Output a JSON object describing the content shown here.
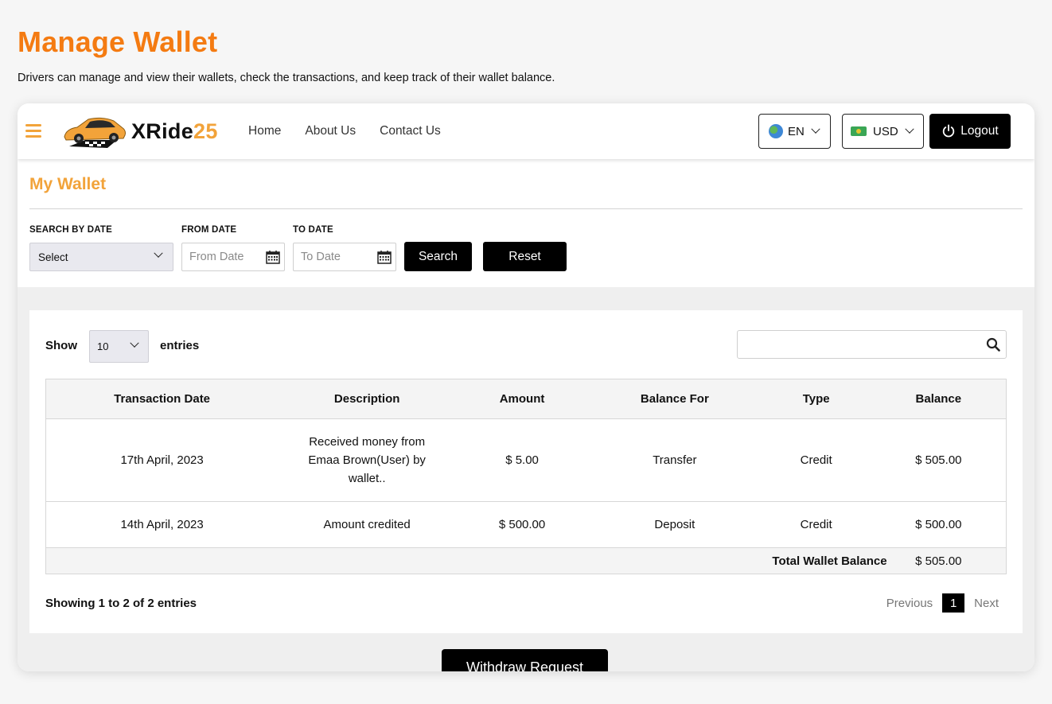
{
  "page": {
    "title": "Manage Wallet",
    "subtitle": "Drivers can manage and view their wallets, check the transactions, and keep track of their wallet balance."
  },
  "navbar": {
    "logo_text_main": "XRide",
    "logo_text_accent": "25",
    "links": [
      "Home",
      "About Us",
      "Contact Us"
    ],
    "language": "EN",
    "currency": "USD",
    "logout_label": "Logout"
  },
  "wallet": {
    "title": "My Wallet",
    "filters": {
      "search_by_date_label": "SEARCH BY DATE",
      "search_by_date_value": "Select",
      "from_date_label": "FROM DATE",
      "from_date_placeholder": "From Date",
      "to_date_label": "TO DATE",
      "to_date_placeholder": "To Date",
      "search_button": "Search",
      "reset_button": "Reset"
    }
  },
  "table_controls": {
    "show_label": "Show",
    "entries_value": "10",
    "entries_label": "entries",
    "search_value": ""
  },
  "table": {
    "headers": [
      "Transaction Date",
      "Description",
      "Amount",
      "Balance For",
      "Type",
      "Balance"
    ],
    "rows": [
      {
        "date": "17th April, 2023",
        "description": "Received money from Emaa Brown(User) by wallet..",
        "amount": "$ 5.00",
        "balance_for": "Transfer",
        "type": "Credit",
        "balance": "$ 505.00"
      },
      {
        "date": "14th April, 2023",
        "description": "Amount credited",
        "amount": "$ 500.00",
        "balance_for": "Deposit",
        "type": "Credit",
        "balance": "$ 500.00"
      }
    ],
    "total_label": "Total Wallet Balance",
    "total_value": "$ 505.00"
  },
  "footer": {
    "info": "Showing 1 to 2 of 2 entries",
    "previous": "Previous",
    "current_page": "1",
    "next": "Next"
  },
  "withdraw_button": "Withdraw Request",
  "colors": {
    "title_orange": "#f47b12",
    "accent_orange": "#f2a33a",
    "button_black": "#000000"
  },
  "icons": [
    "hamburger-icon",
    "car-logo-icon",
    "globe-icon",
    "money-icon",
    "chevron-down-icon",
    "power-icon",
    "calendar-icon",
    "search-icon"
  ]
}
